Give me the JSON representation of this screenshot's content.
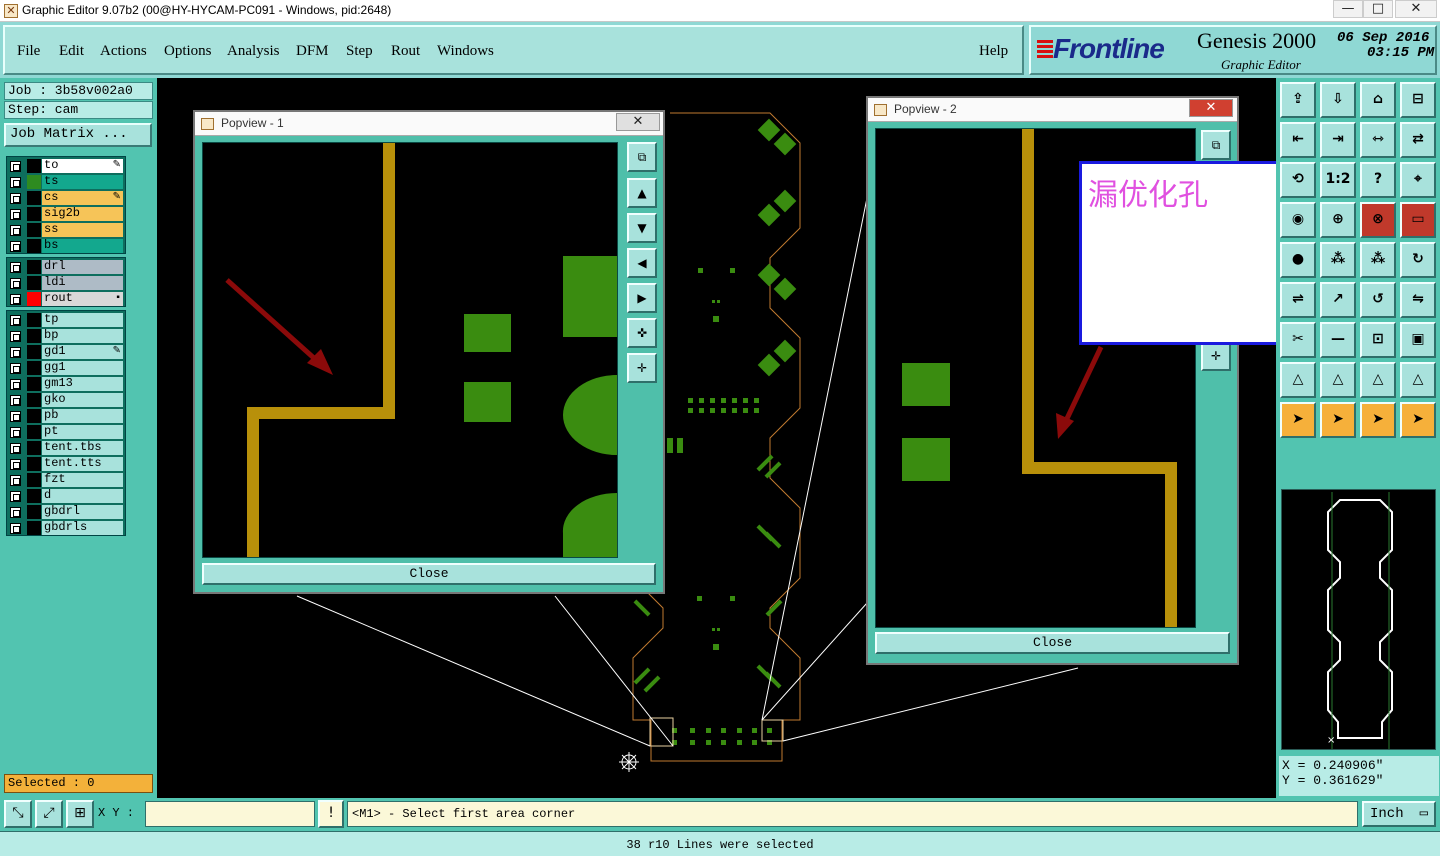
{
  "window": {
    "title": "Graphic Editor 9.07b2 (00@HY-HYCAM-PC091 - Windows, pid:2648)",
    "min": "—",
    "max": "□",
    "close": "✕"
  },
  "menu": {
    "items": [
      "File",
      "Edit",
      "Actions",
      "Options",
      "Analysis",
      "DFM",
      "Step",
      "Rout",
      "Windows"
    ],
    "help": "Help"
  },
  "brand": {
    "logo": "Frontline",
    "product": "Genesis 2000",
    "subtitle": "Graphic Editor",
    "date": "06 Sep 2016",
    "time": "03:15 PM"
  },
  "job": {
    "job_label": "Job : 3b58v002a0",
    "step_label": "Step: cam",
    "matrix_button": "Job Matrix ..."
  },
  "layers": {
    "group1": [
      {
        "name": "to",
        "color": "#ffffff",
        "swatch": "#000000",
        "mark": "pencil"
      },
      {
        "name": "ts",
        "color": "#13a88e",
        "swatch": "#2e8b20",
        "mark": ""
      },
      {
        "name": "cs",
        "color": "#f6c458",
        "swatch": "#000000",
        "mark": "pencil"
      },
      {
        "name": "sig2b",
        "color": "#f6c458",
        "swatch": "#000000",
        "mark": ""
      },
      {
        "name": "ss",
        "color": "#f6c458",
        "swatch": "#000000",
        "mark": ""
      },
      {
        "name": "bs",
        "color": "#13a88e",
        "swatch": "#000000",
        "mark": ""
      }
    ],
    "group2": [
      {
        "name": "drl",
        "color": "#aebbc6",
        "swatch": "#000000",
        "mark": ""
      },
      {
        "name": "ldi",
        "color": "#aebbc6",
        "swatch": "#000000",
        "mark": ""
      },
      {
        "name": "rout",
        "color": "#d8d8d8",
        "swatch": "#ff0000",
        "mark": "box"
      }
    ],
    "group3": [
      {
        "name": "tp",
        "color": "#a8e2dc",
        "swatch": "#000000",
        "mark": ""
      },
      {
        "name": "bp",
        "color": "#a8e2dc",
        "swatch": "#000000",
        "mark": ""
      },
      {
        "name": "gd1",
        "color": "#a8e2dc",
        "swatch": "#000000",
        "mark": "pencil"
      },
      {
        "name": "gg1",
        "color": "#a8e2dc",
        "swatch": "#000000",
        "mark": ""
      },
      {
        "name": "gm13",
        "color": "#a8e2dc",
        "swatch": "#000000",
        "mark": ""
      },
      {
        "name": "gko",
        "color": "#a8e2dc",
        "swatch": "#000000",
        "mark": ""
      },
      {
        "name": "pb",
        "color": "#a8e2dc",
        "swatch": "#000000",
        "mark": ""
      },
      {
        "name": "pt",
        "color": "#a8e2dc",
        "swatch": "#000000",
        "mark": ""
      },
      {
        "name": "tent.tbs",
        "color": "#a8e2dc",
        "swatch": "#000000",
        "mark": ""
      },
      {
        "name": "tent.tts",
        "color": "#a8e2dc",
        "swatch": "#000000",
        "mark": ""
      },
      {
        "name": "fzt",
        "color": "#a8e2dc",
        "swatch": "#000000",
        "mark": ""
      },
      {
        "name": "d",
        "color": "#a8e2dc",
        "swatch": "#000000",
        "mark": ""
      },
      {
        "name": "gbdrl",
        "color": "#a8e2dc",
        "swatch": "#000000",
        "mark": ""
      },
      {
        "name": "gbdrls",
        "color": "#a8e2dc",
        "swatch": "#000000",
        "mark": ""
      }
    ]
  },
  "selected": "Selected : 0",
  "popview1": {
    "title": "Popview - 1",
    "close_x": "✕",
    "close_button": "Close"
  },
  "popview2": {
    "title": "Popview - 2",
    "close_x": "✕",
    "close_button": "Close"
  },
  "annotation": "漏优化孔",
  "coords": {
    "x": "X = 0.240906\"",
    "y": "Y = 0.361629\""
  },
  "bottom": {
    "xy_label": "X Y :",
    "xy_value": "",
    "prompt": "<M1> - Select first area corner",
    "units": "Inch",
    "excl": "!"
  },
  "status": "38 r10 Lines were selected",
  "toolbar": {
    "icons": [
      "zoom-home",
      "zoom-home",
      "home",
      "window-tile",
      "arrow-left-box",
      "arrow-right-box",
      "flip",
      "rotate",
      "scale",
      "ratio-1-2",
      "help",
      "measure",
      "drc",
      "layers-a",
      "layers-b",
      "ruler",
      "pad",
      "snap",
      "snap-b",
      "arc",
      "polygon",
      "move",
      "undo",
      "mirror",
      "cut",
      "line",
      "zoom-box",
      "group",
      "triangle-a",
      "triangle-b",
      "triangle-c",
      "triangle-d",
      "cursor-a",
      "cursor-b",
      "cursor-c",
      "cursor-d"
    ],
    "text": {
      "ratio": "1:2",
      "help": "?"
    }
  },
  "colors": {
    "panel": "#52c4b0",
    "menu": "#a8e2dc",
    "copper": "#3a8c10",
    "trace": "#b8900a",
    "outline": "#c07a30"
  }
}
